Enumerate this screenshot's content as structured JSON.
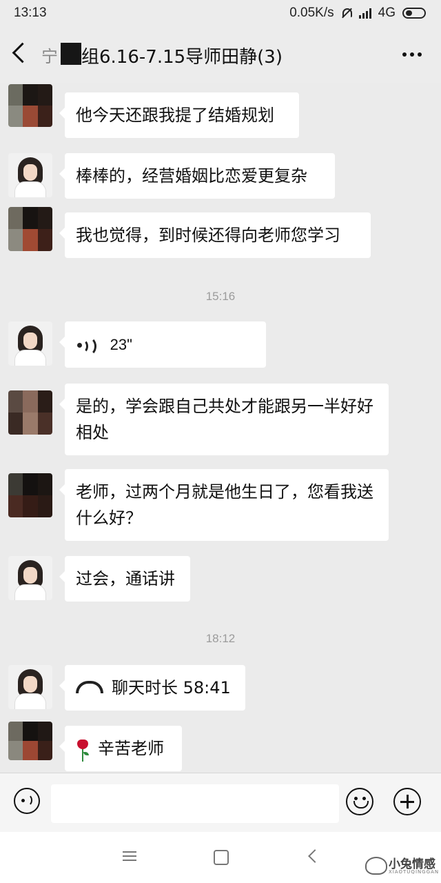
{
  "status_bar": {
    "time": "13:13",
    "network_speed": "0.05K/s",
    "network_type": "4G",
    "icons": [
      "mute-bell-icon",
      "signal-icon",
      "battery-icon"
    ]
  },
  "header": {
    "title_prefix": "宁",
    "title": "组6.16-7.15导师田静(3)",
    "icons": [
      "back-arrow-icon",
      "more-dots-icon"
    ]
  },
  "messages": [
    {
      "sender": "member",
      "text": "他今天还跟我提了结婚规划"
    },
    {
      "sender": "teacher",
      "text": "棒棒的，经营婚姻比恋爱更复杂"
    },
    {
      "sender": "member",
      "text": "我也觉得，到时候还得向老师您学习"
    },
    {
      "type": "timestamp",
      "text": "15:16"
    },
    {
      "sender": "teacher",
      "type": "voice",
      "duration": "23\""
    },
    {
      "sender": "member",
      "text": "是的，学会跟自己共处才能跟另一半好好相处"
    },
    {
      "sender": "member",
      "text": "老师，过两个月就是他生日了，您看我送什么好？"
    },
    {
      "sender": "teacher",
      "text": "过会，通话讲"
    },
    {
      "type": "timestamp",
      "text": "18:12"
    },
    {
      "sender": "teacher",
      "type": "call",
      "text": "聊天时长 58:41"
    },
    {
      "sender": "member",
      "type": "emoji_text",
      "emoji": "rose-icon",
      "text": "辛苦老师"
    }
  ],
  "input_bar": {
    "placeholder": "",
    "icons": [
      "voice-input-icon",
      "emoji-icon",
      "plus-icon"
    ]
  },
  "nav_bar": {
    "icons": [
      "menu-icon",
      "home-icon",
      "back-icon"
    ]
  },
  "watermark": {
    "text": "小兔情感",
    "subtext": "XIAOTUQINGGAN"
  },
  "colors": {
    "background": "#ebebeb",
    "bubble": "#ffffff",
    "timestamp": "#9b9b9b"
  }
}
